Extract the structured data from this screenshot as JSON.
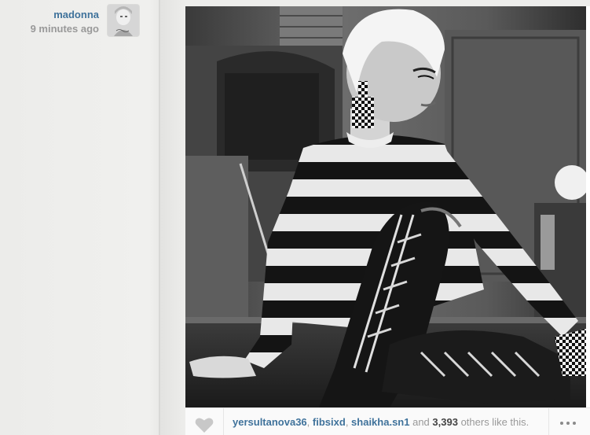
{
  "post": {
    "author": "madonna",
    "time": "9 minutes ago",
    "likes": {
      "likers": [
        "yersultanova36",
        "fibsixd",
        "shaikha.sn1"
      ],
      "separator": ", ",
      "and_text": " and ",
      "count": "3,393",
      "suffix": " others like this."
    }
  },
  "colors": {
    "link": "#3f729b",
    "muted": "#999999"
  },
  "icons": {
    "like": "heart-icon",
    "more": "ellipsis-icon"
  }
}
